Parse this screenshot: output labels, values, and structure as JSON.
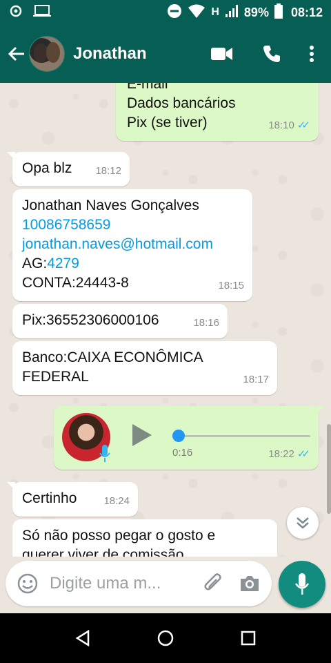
{
  "status_bar": {
    "network": "H",
    "battery": "89%",
    "time": "08:12"
  },
  "header": {
    "contact_name": "Jonathan",
    "icons": [
      "back-arrow-icon",
      "video-call-icon",
      "phone-icon",
      "more-vert-icon"
    ]
  },
  "messages": [
    {
      "dir": "out",
      "lines": [
        "E-mail",
        "Dados bancários",
        "Pix (se tiver)"
      ],
      "time": "18:10",
      "read": true
    },
    {
      "dir": "in",
      "text": "Opa blz",
      "time": "18:12"
    },
    {
      "dir": "in",
      "name_line": "Jonathan Naves Gonçalves",
      "phone": "10086758659",
      "email": "jonathan.naves@hotmail.com",
      "ag_label": "AG:",
      "ag_value": "4279",
      "conta": "CONTA:24443-8",
      "time": "18:15"
    },
    {
      "dir": "in",
      "text": "Pix:36552306000106",
      "time": "18:16"
    },
    {
      "dir": "in",
      "lines": [
        "Banco:CAIXA ECONÔMICA",
        "FEDERAL"
      ],
      "time": "18:17"
    },
    {
      "dir": "out",
      "type": "voice",
      "duration": "0:16",
      "time": "18:22",
      "read": true,
      "progress": 0.0
    },
    {
      "dir": "in",
      "text": "Certinho",
      "time": "18:24"
    },
    {
      "dir": "in",
      "lines": [
        "Só não posso pegar o gosto e",
        "querer viver de comissão"
      ]
    }
  ],
  "composer": {
    "placeholder": "Digite uma m..."
  },
  "colors": {
    "header": "#075e54",
    "outgoing": "#dcf8c6",
    "incoming": "#ffffff",
    "accent": "#128c7e",
    "link": "#039be5",
    "read_ticks": "#34b7f1"
  }
}
